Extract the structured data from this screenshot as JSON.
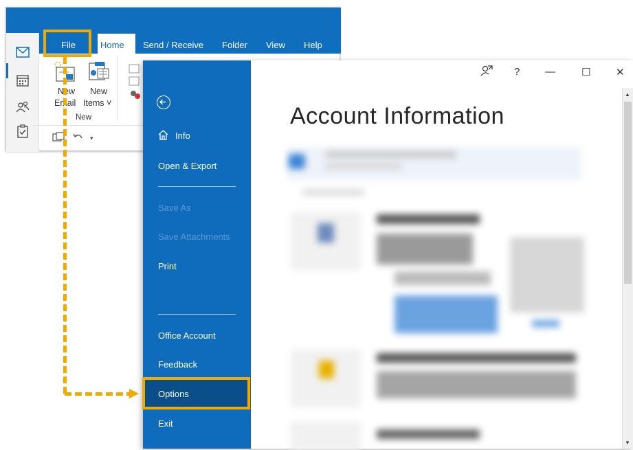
{
  "ribbon": {
    "tabs": [
      "File",
      "Home",
      "Send / Receive",
      "Folder",
      "View",
      "Help"
    ],
    "new_email_line1": "New",
    "new_email_line2": "Email",
    "new_items_line1": "New",
    "new_items_line2": "Items ˅",
    "group_label": "New"
  },
  "backstage": {
    "back_label": "←",
    "menu": {
      "info": "Info",
      "open_export": "Open & Export",
      "save_as": "Save As",
      "save_attachments": "Save Attachments",
      "print": "Print",
      "office_account": "Office Account",
      "feedback": "Feedback",
      "options": "Options",
      "exit": "Exit"
    },
    "title": "Account Information",
    "window_controls": {
      "help": "?",
      "minimize": "—",
      "maximize": "☐",
      "close": "✕"
    }
  },
  "colors": {
    "outlook_blue": "#106ebe",
    "backstage_blue": "#0f6cbd",
    "options_selected": "#0b4f8a",
    "annotation": "#f2a900"
  },
  "icons": [
    "mail-icon",
    "calendar-icon",
    "people-icon",
    "tasks-icon",
    "new-email-icon",
    "new-items-icon",
    "undo-icon",
    "home-icon",
    "back-arrow-icon",
    "coauthor-icon"
  ]
}
